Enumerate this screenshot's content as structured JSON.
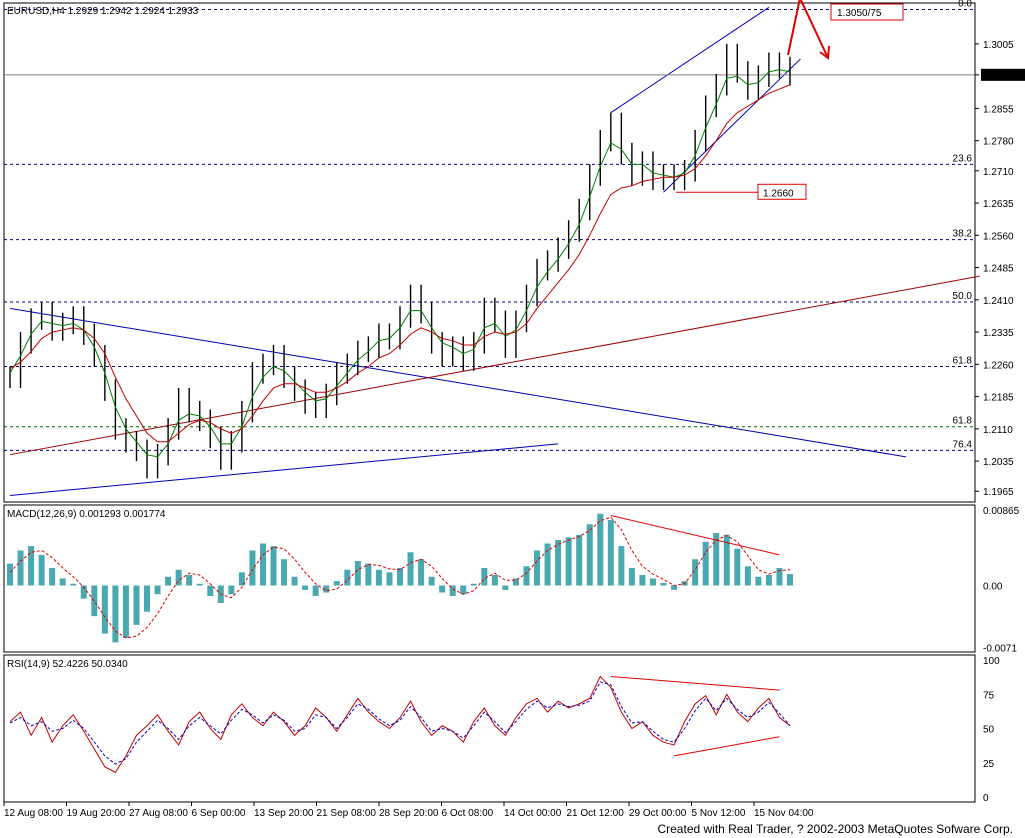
{
  "chart_data": {
    "type": "line",
    "instrument_header": "EURUSD,H4 1.2929 1.2942 1.2924 1.2933",
    "current_price": 1.2933,
    "price_axis": {
      "ylim": [
        1.194,
        1.31
      ],
      "ticks": [
        1.3005,
        1.2933,
        1.2855,
        1.278,
        1.271,
        1.2635,
        1.256,
        1.2485,
        1.241,
        1.2335,
        1.226,
        1.2185,
        1.211,
        1.2035,
        1.1965
      ],
      "tick_labels": [
        "1.3005",
        "1.2933",
        "1.2855",
        "1.2780",
        "1.2710",
        "1.2635",
        "1.2560",
        "1.2485",
        "1.2410",
        "1.2335",
        "1.2260",
        "1.2185",
        "1.2110",
        "1.2035",
        "1.1965"
      ]
    },
    "fib_levels": [
      {
        "label": "0.0",
        "value": 1.3085,
        "color": "#000080"
      },
      {
        "label": "23.6",
        "value": 1.2725,
        "color": "#000080"
      },
      {
        "label": "38.2",
        "value": 1.255,
        "color": "#000080"
      },
      {
        "label": "50.0",
        "value": 1.2405,
        "color": "#000080"
      },
      {
        "label": "61.8",
        "value": 1.2255,
        "color": "#000080"
      },
      {
        "label": "61.8",
        "value": 1.2115,
        "color": "#006400"
      },
      {
        "label": "76.4",
        "value": 1.206,
        "color": "#000080"
      }
    ],
    "annotations": [
      {
        "text": "1.3050/75",
        "price": 1.3065
      },
      {
        "text": "1.2660",
        "price": 1.266
      }
    ],
    "x_labels": [
      "12 Aug 08:00",
      "19 Aug 20:00",
      "27 Aug 08:00",
      "6 Sep 00:00",
      "13 Sep 20:00",
      "21 Sep 08:00",
      "28 Sep 20:00",
      "6 Oct 08:00",
      "14 Oct 00:00",
      "21 Oct 12:00",
      "29 Oct 00:00",
      "5 Nov 12:00",
      "15 Nov 04:00"
    ],
    "price_series": [
      {
        "name": "close",
        "color": "#000000",
        "values": [
          1.223,
          1.231,
          1.2365,
          1.238,
          1.234,
          1.2355,
          1.237,
          1.233,
          1.228,
          1.22,
          1.211,
          1.208,
          1.206,
          1.202,
          1.205,
          1.211,
          1.218,
          1.215,
          1.213,
          1.209,
          1.204,
          1.208,
          1.215,
          1.224,
          1.226,
          1.228,
          1.223,
          1.22,
          1.217,
          1.216,
          1.219,
          1.224,
          1.226,
          1.229,
          1.23,
          1.233,
          1.232,
          1.237,
          1.242,
          1.238,
          1.231,
          1.228,
          1.23,
          1.227,
          1.231,
          1.239,
          1.236,
          1.23,
          1.236,
          1.242,
          1.248,
          1.25,
          1.253,
          1.257,
          1.262,
          1.27,
          1.278,
          1.282,
          1.275,
          1.27,
          1.273,
          1.269,
          1.27,
          1.269,
          1.271,
          1.278,
          1.286,
          1.291,
          1.298,
          1.294,
          1.29,
          1.293,
          1.296,
          1.295,
          1.2933
        ]
      },
      {
        "name": "ma-fast",
        "color": "#008000",
        "values": [
          1.224,
          1.228,
          1.233,
          1.236,
          1.2355,
          1.235,
          1.2355,
          1.234,
          1.23,
          1.224,
          1.216,
          1.211,
          1.208,
          1.205,
          1.2045,
          1.2075,
          1.213,
          1.2145,
          1.214,
          1.2115,
          1.2075,
          1.2075,
          1.2115,
          1.2185,
          1.223,
          1.2255,
          1.2245,
          1.222,
          1.2195,
          1.2175,
          1.218,
          1.221,
          1.224,
          1.227,
          1.229,
          1.2315,
          1.232,
          1.2345,
          1.2385,
          1.2385,
          1.2345,
          1.231,
          1.23,
          1.2285,
          1.2295,
          1.2345,
          1.2355,
          1.2325,
          1.234,
          1.2385,
          1.244,
          1.2475,
          1.2505,
          1.254,
          1.2585,
          1.265,
          1.272,
          1.2775,
          1.276,
          1.2725,
          1.2725,
          1.2705,
          1.27,
          1.2695,
          1.2705,
          1.2745,
          1.281,
          1.2865,
          1.2925,
          1.293,
          1.291,
          1.2915,
          1.294,
          1.2945,
          1.294
        ]
      },
      {
        "name": "ma-slow",
        "color": "#c00000",
        "values": [
          1.225,
          1.2265,
          1.229,
          1.232,
          1.2335,
          1.234,
          1.2345,
          1.234,
          1.232,
          1.2285,
          1.223,
          1.218,
          1.214,
          1.21,
          1.208,
          1.208,
          1.21,
          1.212,
          1.213,
          1.2125,
          1.211,
          1.21,
          1.211,
          1.214,
          1.2175,
          1.2205,
          1.2215,
          1.2215,
          1.2205,
          1.2195,
          1.2195,
          1.2205,
          1.222,
          1.224,
          1.2255,
          1.2275,
          1.2285,
          1.2305,
          1.233,
          1.2345,
          1.2335,
          1.232,
          1.2315,
          1.2305,
          1.2305,
          1.2325,
          1.2335,
          1.233,
          1.2335,
          1.2355,
          1.239,
          1.242,
          1.245,
          1.248,
          1.2515,
          1.256,
          1.261,
          1.2655,
          1.267,
          1.2675,
          1.2685,
          1.269,
          1.2695,
          1.2695,
          1.27,
          1.2715,
          1.2745,
          1.278,
          1.282,
          1.2845,
          1.286,
          1.2875,
          1.289,
          1.29,
          1.291
        ]
      }
    ],
    "macd": {
      "header": "MACD(12,26,9)  0.001293  0.001774",
      "ticks": [
        "0.00865",
        "0.00",
        "-0.0071"
      ],
      "ylim": [
        -0.0076,
        0.0092
      ],
      "histogram": [
        0.0025,
        0.004,
        0.0045,
        0.0035,
        0.002,
        0.0008,
        0.0002,
        -0.0015,
        -0.0035,
        -0.0055,
        -0.0065,
        -0.006,
        -0.0045,
        -0.003,
        -0.001,
        0.001,
        0.0018,
        0.0012,
        0.0002,
        -0.0012,
        -0.002,
        -0.001,
        0.0015,
        0.004,
        0.0048,
        0.0045,
        0.003,
        0.001,
        -0.0005,
        -0.0012,
        -0.0008,
        0.0005,
        0.0018,
        0.0028,
        0.0025,
        0.0018,
        0.0015,
        0.002,
        0.0038,
        0.003,
        0.001,
        -0.0008,
        -0.0012,
        -0.001,
        0.0002,
        0.002,
        0.0012,
        -0.0005,
        0.0008,
        0.0022,
        0.004,
        0.0048,
        0.0052,
        0.0055,
        0.0058,
        0.007,
        0.0082,
        0.0075,
        0.0045,
        0.002,
        0.0012,
        0.0008,
        0.0003,
        -0.0005,
        0.0005,
        0.003,
        0.005,
        0.006,
        0.0058,
        0.0042,
        0.0022,
        0.001,
        0.0012,
        0.002,
        0.0013
      ],
      "signal": [
        0.0015,
        0.0028,
        0.0038,
        0.004,
        0.0032,
        0.002,
        0.001,
        -0.0002,
        -0.0018,
        -0.0036,
        -0.0052,
        -0.006,
        -0.0058,
        -0.0048,
        -0.0032,
        -0.0012,
        0.0006,
        0.0014,
        0.0012,
        0.0002,
        -0.001,
        -0.0014,
        -0.0002,
        0.0018,
        0.0035,
        0.0044,
        0.0042,
        0.003,
        0.0015,
        0.0002,
        -0.0006,
        -0.0004,
        0.0006,
        0.0018,
        0.0024,
        0.0023,
        0.0019,
        0.0018,
        0.0026,
        0.003,
        0.0022,
        0.0008,
        -0.0004,
        -0.001,
        -0.0006,
        0.0008,
        0.0014,
        0.0006,
        0.0006,
        0.0014,
        0.0028,
        0.004,
        0.0047,
        0.0052,
        0.0056,
        0.0063,
        0.0074,
        0.0078,
        0.0064,
        0.004,
        0.0022,
        0.0013,
        0.0007,
        0.0,
        0.0002,
        0.0018,
        0.0038,
        0.0052,
        0.0057,
        0.005,
        0.0034,
        0.0018,
        0.0013,
        0.0017,
        0.0018
      ],
      "trend_line": {
        "from": [
          0.008,
          57
        ],
        "to": [
          0.0035,
          73
        ]
      }
    },
    "rsi": {
      "header": "RSI(14,9)  52.4226  50.0340",
      "ticks": [
        "100",
        "75",
        "50",
        "25",
        "0"
      ],
      "ylim": [
        0,
        100
      ],
      "rsi_values": [
        55,
        62,
        45,
        58,
        40,
        52,
        60,
        48,
        35,
        22,
        18,
        30,
        45,
        52,
        60,
        48,
        38,
        55,
        62,
        50,
        42,
        60,
        68,
        58,
        52,
        62,
        55,
        45,
        52,
        65,
        58,
        48,
        60,
        72,
        62,
        55,
        50,
        58,
        70,
        55,
        45,
        52,
        48,
        40,
        55,
        65,
        52,
        45,
        58,
        68,
        72,
        62,
        70,
        65,
        68,
        72,
        88,
        80,
        62,
        50,
        55,
        45,
        40,
        38,
        55,
        68,
        74,
        60,
        75,
        62,
        55,
        65,
        72,
        58,
        52
      ],
      "signal_values": [
        54,
        58,
        52,
        55,
        48,
        50,
        56,
        50,
        40,
        30,
        24,
        28,
        40,
        48,
        56,
        50,
        42,
        52,
        58,
        52,
        46,
        56,
        64,
        60,
        54,
        60,
        56,
        48,
        50,
        60,
        58,
        50,
        58,
        68,
        64,
        57,
        52,
        56,
        66,
        58,
        48,
        50,
        48,
        43,
        52,
        62,
        55,
        47,
        55,
        64,
        70,
        65,
        68,
        66,
        67,
        70,
        84,
        82,
        66,
        54,
        55,
        48,
        42,
        40,
        50,
        63,
        72,
        63,
        72,
        64,
        58,
        62,
        69,
        61,
        52
      ],
      "trend_lines": [
        {
          "from": [
            88,
            57
          ],
          "to": [
            78,
            73
          ]
        },
        {
          "from": [
            30,
            63
          ],
          "to": [
            44,
            73
          ]
        }
      ]
    },
    "channel_lines": [
      {
        "name": "upper-wedge",
        "from": [
          57,
          1.2845
        ],
        "to": [
          72,
          1.309
        ]
      },
      {
        "name": "lower-wedge",
        "from": [
          62,
          1.266
        ],
        "to": [
          75,
          1.297
        ]
      },
      {
        "name": "long-desc",
        "from": [
          0,
          1.239
        ],
        "to": [
          85,
          1.2045
        ]
      },
      {
        "name": "long-asc-red",
        "from": [
          0,
          1.205
        ],
        "to": [
          92,
          1.2465
        ]
      },
      {
        "name": "low-asc-blue",
        "from": [
          0,
          1.1955
        ],
        "to": [
          52,
          1.2075
        ]
      }
    ]
  },
  "footer_text": "Created with Real Trader, ? 2002-2003 MetaQuotes Sofware Corp."
}
